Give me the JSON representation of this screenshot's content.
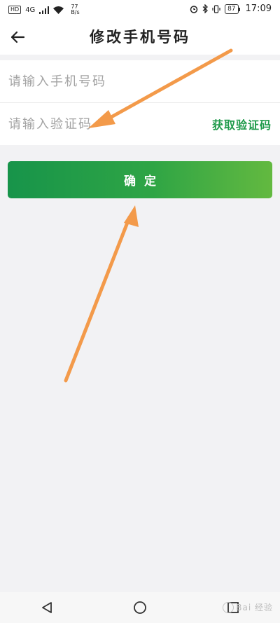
{
  "status_bar": {
    "hd": "HD",
    "signal": "4G",
    "net_speed_value": "77",
    "net_speed_unit": "B/s",
    "battery": "87",
    "time": "17:09"
  },
  "header": {
    "title": "修改手机号码"
  },
  "form": {
    "phone_placeholder": "请输入手机号码",
    "code_placeholder": "请输入验证码",
    "get_code_label": "获取验证码"
  },
  "confirm_button": {
    "label": "确定"
  },
  "watermark": {
    "text": "Bai 经验"
  },
  "colors": {
    "accent": "#1e9a4a",
    "annotation_arrow": "#f39a4a"
  }
}
